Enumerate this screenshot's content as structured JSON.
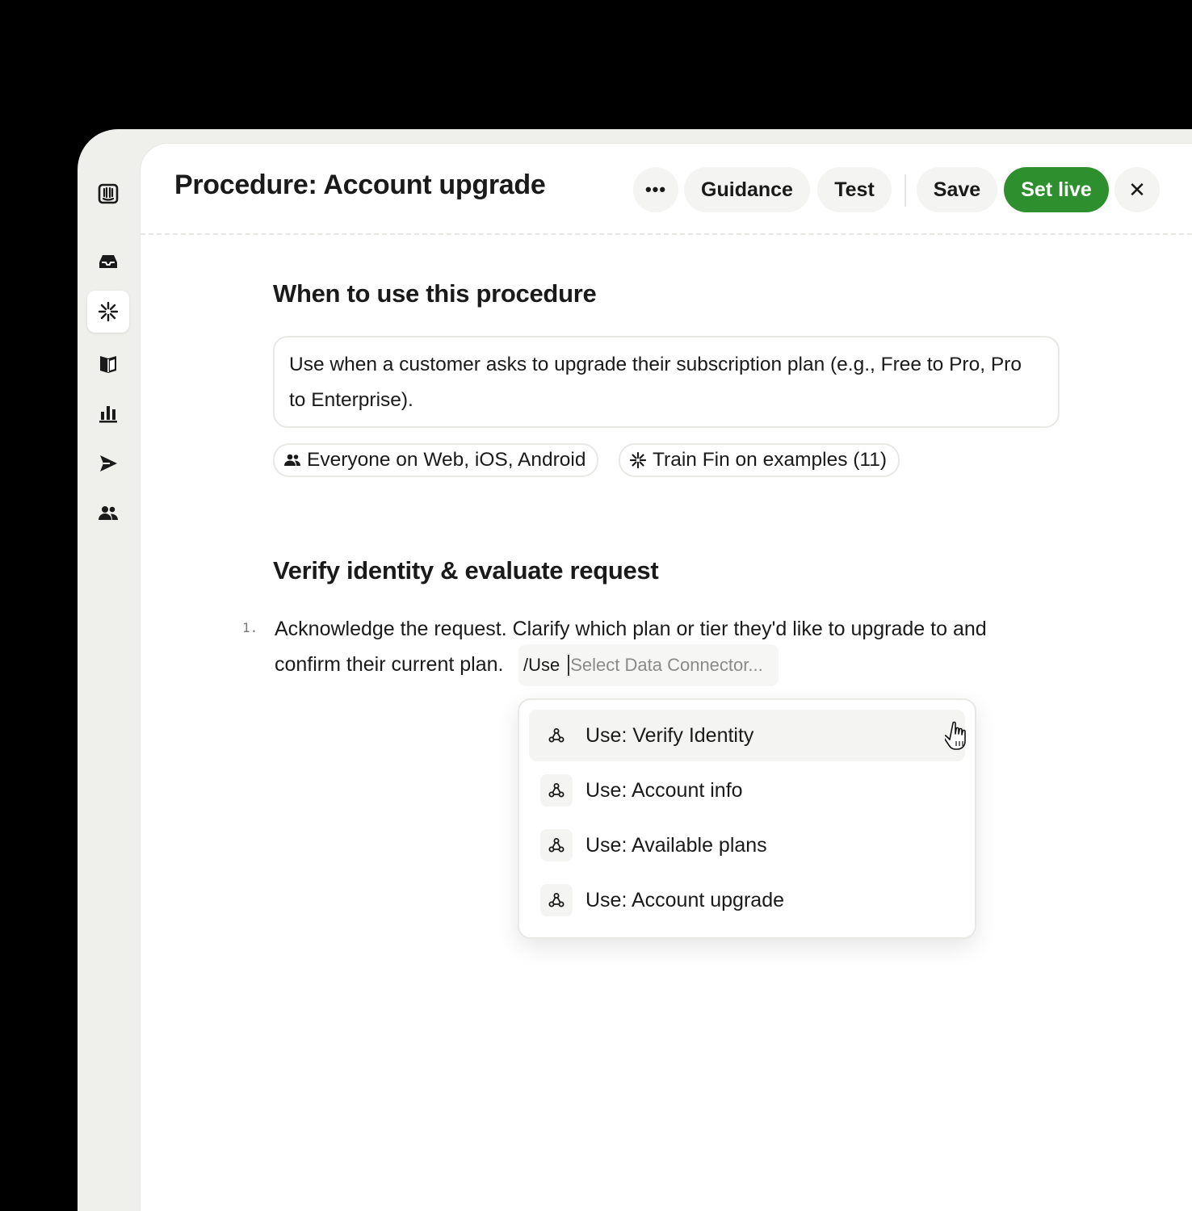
{
  "header": {
    "title": "Procedure: Account upgrade",
    "more_label": "•••",
    "guidance_label": "Guidance",
    "test_label": "Test",
    "save_label": "Save",
    "set_live_label": "Set live",
    "close_label": "✕"
  },
  "sidebar": {
    "items": [
      {
        "icon": "intercom-logo-icon"
      },
      {
        "icon": "inbox-icon"
      },
      {
        "icon": "fin-sparkle-icon",
        "active": true
      },
      {
        "icon": "book-icon"
      },
      {
        "icon": "bar-chart-icon"
      },
      {
        "icon": "send-icon"
      },
      {
        "icon": "contacts-icon"
      }
    ]
  },
  "when_section": {
    "title": "When to use this procedure",
    "description": "Use when a customer asks to upgrade their subscription plan (e.g., Free to Pro, Pro to Enterprise).",
    "audience_chip": "Everyone on Web, iOS, Android",
    "train_chip": "Train Fin on examples (11)"
  },
  "verify_section": {
    "title": "Verify identity & evaluate request",
    "step_number": "1.",
    "step_text": "Acknowledge the request. Clarify which plan or tier they'd like to upgrade to and confirm their current plan.",
    "command_prefix": "/Use",
    "connector_placeholder": "Select Data Connector..."
  },
  "dropdown": {
    "items": [
      {
        "label": "Use: Verify Identity",
        "hovered": true
      },
      {
        "label": "Use: Account info"
      },
      {
        "label": "Use: Available plans"
      },
      {
        "label": "Use: Account upgrade"
      }
    ]
  },
  "colors": {
    "accent_green": "#2e8f2e",
    "sidebar_bg": "#efefec",
    "window_bg": "#000000"
  }
}
